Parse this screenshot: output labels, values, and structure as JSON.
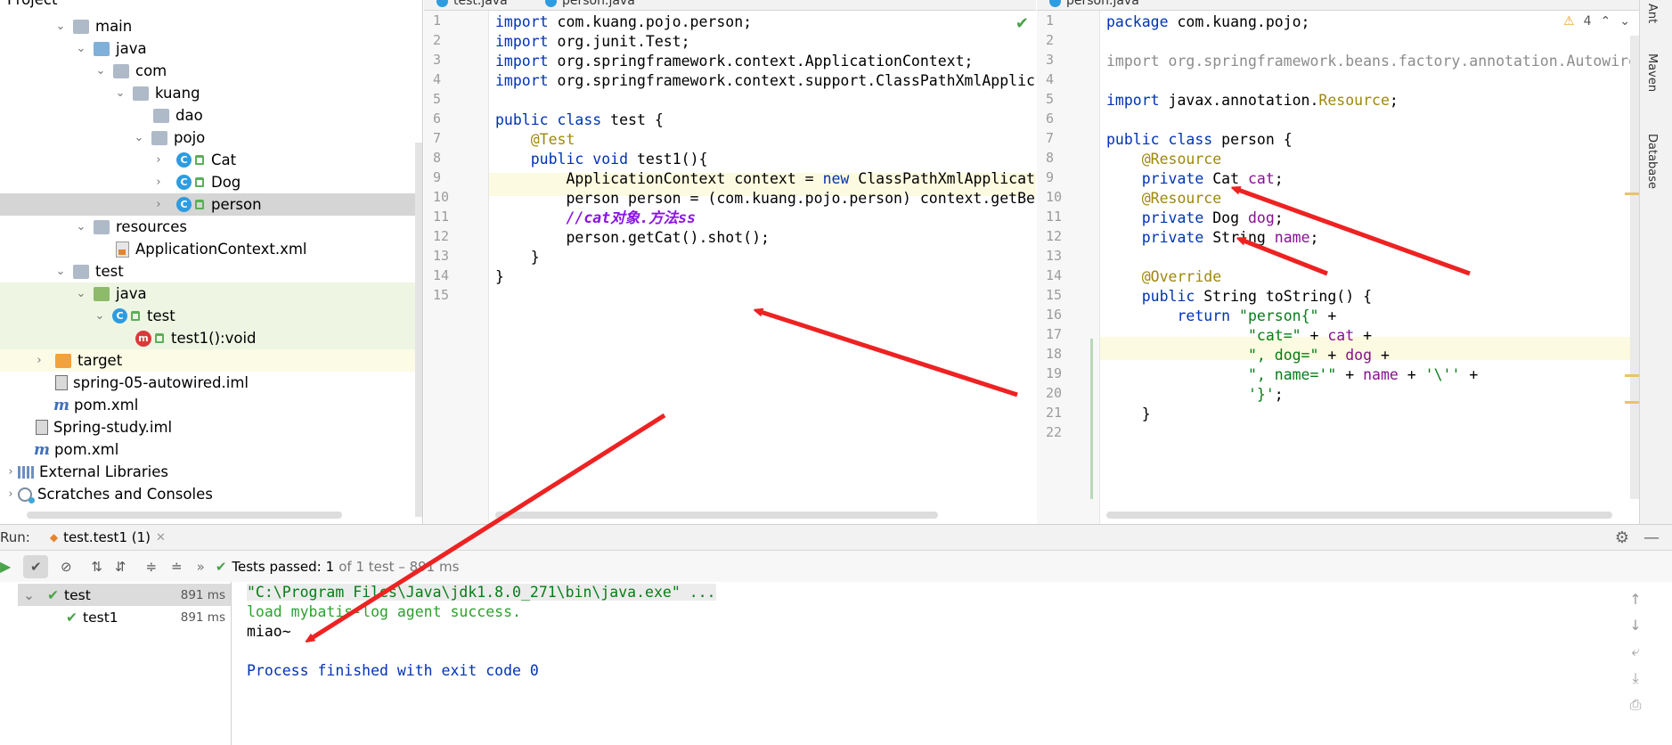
{
  "project_tree": {
    "header_label": "Project",
    "items": [
      {
        "label": "main",
        "kind": "folder"
      },
      {
        "label": "java",
        "kind": "folder-blue"
      },
      {
        "label": "com",
        "kind": "package"
      },
      {
        "label": "kuang",
        "kind": "package"
      },
      {
        "label": "dao",
        "kind": "package"
      },
      {
        "label": "pojo",
        "kind": "package"
      },
      {
        "label": "Cat",
        "kind": "class"
      },
      {
        "label": "Dog",
        "kind": "class"
      },
      {
        "label": "person",
        "kind": "class"
      },
      {
        "label": "resources",
        "kind": "folder-res"
      },
      {
        "label": "ApplicationContext.xml",
        "kind": "xml"
      },
      {
        "label": "test",
        "kind": "folder"
      },
      {
        "label": "java",
        "kind": "folder-green"
      },
      {
        "label": "test",
        "kind": "class"
      },
      {
        "label": "test1():void",
        "kind": "method"
      },
      {
        "label": "target",
        "kind": "folder-orange"
      },
      {
        "label": "spring-05-autowired.iml",
        "kind": "iml"
      },
      {
        "label": "pom.xml",
        "kind": "maven"
      },
      {
        "label": "Spring-study.iml",
        "kind": "iml"
      },
      {
        "label": "pom.xml",
        "kind": "maven"
      },
      {
        "label": "External Libraries",
        "kind": "lib"
      },
      {
        "label": "Scratches and Consoles",
        "kind": "scratch"
      }
    ]
  },
  "editor_left": {
    "tab1": "test.java",
    "tab2": "person.java",
    "lines": [
      "import com.kuang.pojo.person;",
      "import org.junit.Test;",
      "import org.springframework.context.ApplicationContext;",
      "import org.springframework.context.support.ClassPathXmlApplic",
      "",
      "public class test {",
      "    @Test",
      "    public void test1(){",
      "        ApplicationContext context = new ClassPathXmlApplicat",
      "        person person = (com.kuang.pojo.person) context.getBe",
      "        //cat对象.方法ss",
      "        person.getCat().shot();",
      "    }",
      "}",
      ""
    ]
  },
  "editor_right": {
    "tab": "person.java",
    "warning_count": "4",
    "lines": [
      "package com.kuang.pojo;",
      "",
      "import org.springframework.beans.factory.annotation.Autowired",
      "",
      "import javax.annotation.Resource;",
      "",
      "public class person {",
      "    @Resource",
      "    private Cat cat;",
      "    @Resource",
      "    private Dog dog;",
      "    private String name;",
      "",
      "    @Override",
      "    public String toString() {",
      "        return \"person{\" +",
      "                \"cat=\" + cat +",
      "                \", dog=\" + dog +",
      "                \", name='\" + name + '\\'' +",
      "                '}';",
      "    }",
      ""
    ]
  },
  "right_sidebar": {
    "ant": "Ant",
    "maven": "Maven",
    "database": "Database"
  },
  "run_panel": {
    "run_label": "Run:",
    "tab_label": "test.test1 (1)",
    "status_prefix": "Tests passed:",
    "status_count": "1",
    "status_rest": "of 1 test – 891 ms",
    "tree": [
      {
        "label": "test",
        "time": "891 ms"
      },
      {
        "label": "test1",
        "time": "891 ms"
      }
    ],
    "console": [
      "\"C:\\Program Files\\Java\\jdk1.8.0_271\\bin\\java.exe\" ...",
      "load mybatis-log agent success.",
      "miao~",
      "",
      "Process finished with exit code 0"
    ]
  },
  "colors": {
    "keyword": "#0033b3",
    "annotation": "#9e880d",
    "string": "#067d17",
    "field": "#871094",
    "arrow": "#ee2222"
  }
}
